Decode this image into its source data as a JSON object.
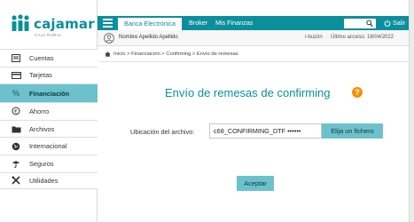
{
  "brand": {
    "name": "cajamar",
    "subtitle": "CAJA RURAL"
  },
  "topbar": {
    "tabs": [
      {
        "label": "Banca Electrónica",
        "active": true
      },
      {
        "label": "Broker",
        "active": false
      },
      {
        "label": "Mis Finanzas",
        "active": false
      }
    ],
    "search_value": "",
    "logout_label": "Salir"
  },
  "userbar": {
    "user_name": "Nombre Apellido Apellido",
    "mailbox": "i-buzón",
    "last_access": "Último acceso: 18/04/2022"
  },
  "sidebar": {
    "items": [
      {
        "label": "Cuentas",
        "icon": "wallet-icon",
        "active": false
      },
      {
        "label": "Tarjetas",
        "icon": "card-icon",
        "active": false
      },
      {
        "label": "Financiación",
        "icon": "percent-icon",
        "active": true
      },
      {
        "label": "Ahorro",
        "icon": "savings-icon",
        "active": false
      },
      {
        "label": "Archivos",
        "icon": "folder-icon",
        "active": false
      },
      {
        "label": "Internacional",
        "icon": "globe-icon",
        "active": false
      },
      {
        "label": "Seguros",
        "icon": "umbrella-icon",
        "active": false
      },
      {
        "label": "Utilidades",
        "icon": "tools-icon",
        "active": false
      }
    ]
  },
  "breadcrumb": "Inicio > Financiación > Confirming > Envío de remesas",
  "main": {
    "title": "Envío de remesas de confirming",
    "help_symbol": "?",
    "file_label": "Ubicación del archivo:",
    "file_value": "c68_CONFIRMING_DTF ••••••",
    "file_button": "Elija un fichero",
    "accept_button": "Aceptar"
  },
  "colors": {
    "brand_teal": "#0c8f9c",
    "accent_light_teal": "#6cc2cc",
    "help_orange": "#f29200"
  }
}
